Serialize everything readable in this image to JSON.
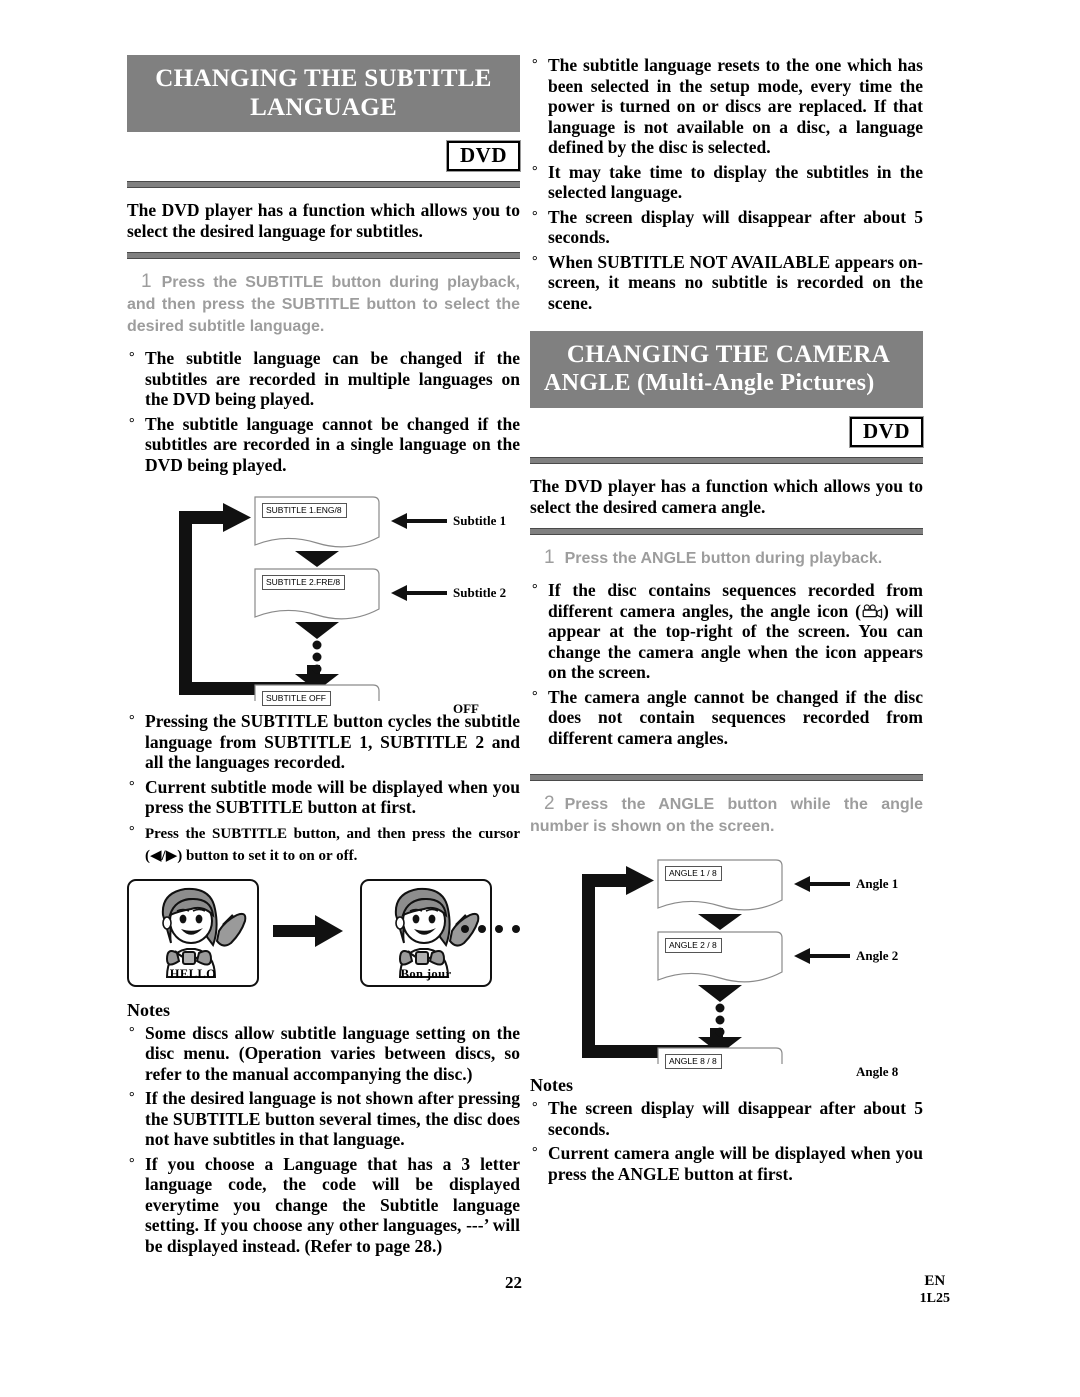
{
  "document": {
    "page_number": "22",
    "footer_lang": "EN",
    "footer_code": "1L25"
  },
  "left_column": {
    "section": {
      "title_line1": "CHANGING THE SUBTITLE",
      "title_line2": "LANGUAGE",
      "badge": "DVD",
      "lead": "The DVD player has a function which allows you to select the desired language for subtitles."
    },
    "step": {
      "number": "1",
      "text": "Press the SUBTITLE button during playback, and then press the SUBTITLE button to select the desired subtitle language."
    },
    "bullets_top": [
      "The subtitle language can be changed if the subtitles are recorded in multiple languages on the DVD being played.",
      "The subtitle language cannot be changed if the subtitles are recorded in a single language on the DVD being played."
    ],
    "diagram": {
      "screens": [
        {
          "osd": "SUBTITLE 1.ENG/8",
          "label": "Subtitle 1"
        },
        {
          "osd": "SUBTITLE 2.FRE/8",
          "label": "Subtitle 2"
        },
        {
          "osd": "SUBTITLE OFF",
          "label": "OFF"
        }
      ]
    },
    "bullets_mid": [
      "Pressing the SUBTITLE button cycles the subtitle language from SUBTITLE 1, SUBTITLE 2 and all the languages recorded.",
      "Current subtitle mode will be displayed when you press the SUBTITLE button at first.",
      "Press the SUBTITLE button, and then press the cursor (◀/▶) button to set it to on or off."
    ],
    "illustration": {
      "caption_first": "HELLO",
      "caption_second": "Bon jour"
    },
    "notes": {
      "title": "Notes",
      "items": [
        "Some discs allow subtitle language setting on the disc menu. (Operation varies between discs, so refer to the manual accompanying the disc.)",
        "If the desired language is not shown after pressing the SUBTITLE button several times, the disc does not have subtitles in that language.",
        "If you choose a Language that has a 3 letter language code, the code will be displayed everytime you change the Subtitle language setting. If you choose any other languages, ---’ will be displayed instead. (Refer to page 28.)"
      ]
    }
  },
  "right_column": {
    "bullets_top": [
      "The subtitle language resets to the one which has been selected in the setup mode, every time the power is turned on or discs are replaced. If that language is not available on a disc, a language defined by the disc is selected.",
      "It may take time to display the subtitles in the selected language.",
      "The screen display will disappear after about 5 seconds.",
      "When  SUBTITLE NOT AVAILABLE  appears on-screen, it means no subtitle is recorded on the scene."
    ],
    "section": {
      "title_line1": "CHANGING THE CAMERA",
      "title_line2": "ANGLE (Multi-Angle Pictures)",
      "badge": "DVD",
      "lead": "The DVD player has a function which allows you to select the desired camera angle."
    },
    "step1": {
      "number": "1",
      "text": "Press the ANGLE button during playback."
    },
    "bullets_mid": [
      {
        "part1": "If the disc contains sequences recorded from different camera angles, the angle icon (",
        "icon": "camera-angle-icon",
        "part2": ") will appear at the top-right of the screen. You can change the camera angle when the icon appears on the screen."
      },
      {
        "text": "The camera angle cannot be changed if the disc does not contain sequences recorded from different camera angles."
      }
    ],
    "step2": {
      "number": "2",
      "text": "Press the ANGLE button while the angle number is shown on the screen."
    },
    "diagram": {
      "screens": [
        {
          "osd": "ANGLE  1 / 8",
          "label": "Angle 1"
        },
        {
          "osd": "ANGLE  2 / 8",
          "label": "Angle 2"
        },
        {
          "osd": "ANGLE  8 / 8",
          "label": "Angle 8"
        }
      ]
    },
    "notes": {
      "title": "Notes",
      "items": [
        "The screen display will disappear after about 5 seconds.",
        "Current camera angle will be displayed when you press the ANGLE button at first."
      ]
    }
  },
  "colors": {
    "header_gray": "#808080",
    "step_gray": "#9d9d9d"
  }
}
